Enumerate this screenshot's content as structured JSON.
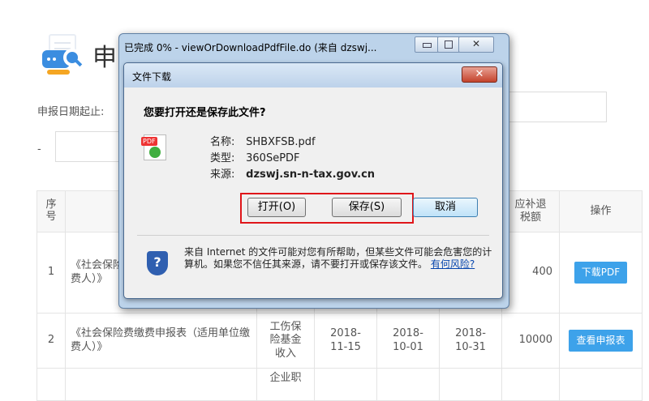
{
  "page": {
    "title_char": "申",
    "date_label": "申报日期起止:",
    "dash": "-"
  },
  "table": {
    "headers": {
      "seq": "序号",
      "refund": "应补退税额",
      "actions": "操作"
    },
    "rows": [
      {
        "seq": "1",
        "name": "《社会保险费缴费申报表（适用单位缴费人）》",
        "refund": "400",
        "action": "下载PDF"
      },
      {
        "seq": "2",
        "name": "《社会保险费缴费申报表（适用单位缴费人）》",
        "type": "工伤保险基金收入",
        "d1": "2018-11-15",
        "d2": "2018-10-01",
        "d3": "2018-10-31",
        "refund": "10000",
        "action": "查看申报表"
      },
      {
        "seq": "",
        "type": "企业职"
      }
    ]
  },
  "download_window": {
    "title": "已完成 0% - viewOrDownloadPdfFile.do (来自 dzswj...",
    "close_glyph": "✕"
  },
  "file_dialog": {
    "title": "文件下载",
    "close_glyph": "✕",
    "question": "您要打开还是保存此文件?",
    "name_label": "名称:",
    "name_value": "SHBXFSB.pdf",
    "type_label": "类型:",
    "type_value": "360SePDF",
    "source_label": "来源:",
    "source_value": "dzswj.sn-n-tax.gov.cn",
    "open_label": "打开(O)",
    "save_label": "保存(S)",
    "cancel_label": "取消",
    "warning": "来自 Internet 的文件可能对您有所帮助，但某些文件可能会危害您的计算机。如果您不信任其来源，请不要打开或保存该文件。",
    "risk_link": "有何风险?",
    "icon_tag": "PDF",
    "shield_glyph": "?"
  }
}
